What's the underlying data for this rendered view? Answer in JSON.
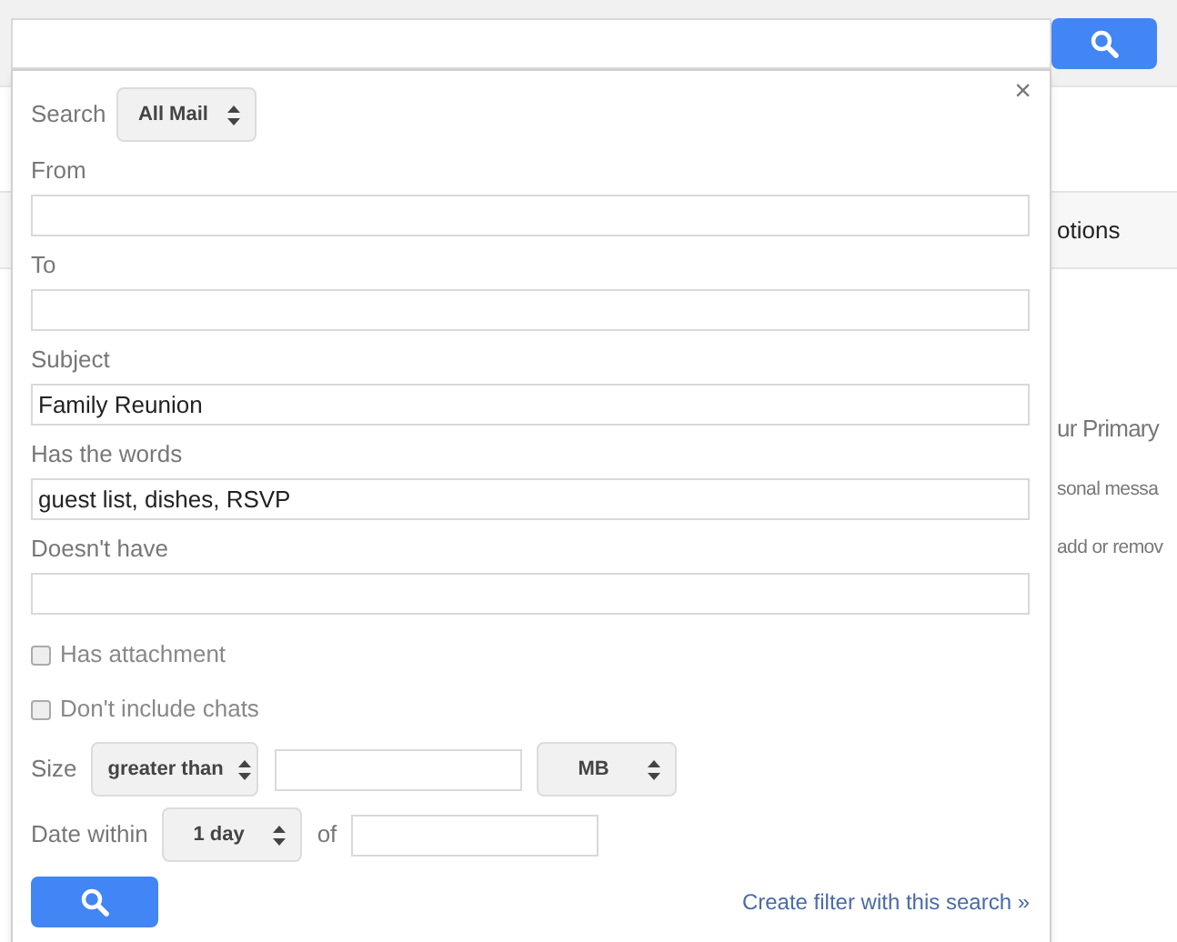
{
  "background": {
    "tab_label": "otions",
    "heading": "ur Primary",
    "lines": [
      "sonal messa",
      "add or remov"
    ]
  },
  "panel": {
    "close": "×",
    "scope": {
      "label": "Search",
      "value": "All Mail"
    },
    "fields": [
      {
        "label": "From"
      },
      {
        "label": "To"
      },
      {
        "label": "Subject",
        "value": "Family Reunion"
      },
      {
        "label": "Has the words",
        "value": "guest list, dishes, RSVP"
      },
      {
        "label": "Doesn't have"
      }
    ],
    "checkboxes": [
      {
        "label": "Has attachment",
        "checked": false
      },
      {
        "label": "Don't include chats",
        "checked": false
      }
    ],
    "size": {
      "label": "Size",
      "comparator": "greater than",
      "unit": "MB"
    },
    "date": {
      "label": "Date within",
      "value": "1 day",
      "of_label": "of"
    },
    "create_filter_link": "Create filter with this search »"
  }
}
